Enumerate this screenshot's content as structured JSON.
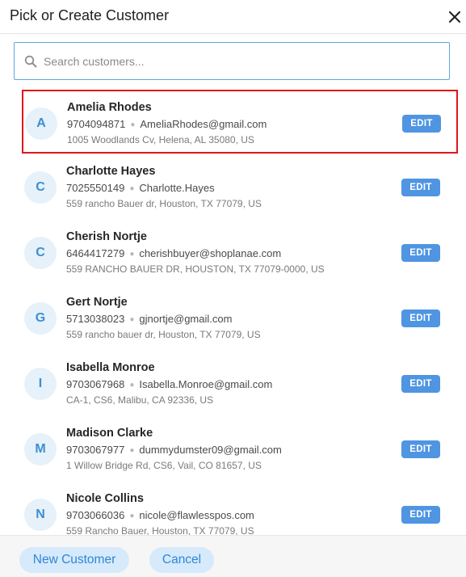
{
  "dialog": {
    "title": "Pick or Create Customer",
    "close_icon": "close-icon"
  },
  "search": {
    "placeholder": "Search customers...",
    "value": "",
    "icon": "search-icon"
  },
  "customers": [
    {
      "initial": "A",
      "name": "Amelia Rhodes",
      "phone": "9704094871",
      "email": "AmeliaRhodes@gmail.com",
      "address": "1005 Woodlands Cv, Helena, AL 35080, US",
      "selected": true
    },
    {
      "initial": "C",
      "name": "Charlotte Hayes",
      "phone": "7025550149",
      "email": "Charlotte.Hayes",
      "address": "559 rancho Bauer dr, Houston, TX 77079, US",
      "selected": false
    },
    {
      "initial": "C",
      "name": "Cherish Nortje",
      "phone": "6464417279",
      "email": "cherishbuyer@shoplanae.com",
      "address": "559 RANCHO BAUER DR, HOUSTON, TX 77079-0000, US",
      "selected": false
    },
    {
      "initial": "G",
      "name": "Gert Nortje",
      "phone": "5713038023",
      "email": "gjnortje@gmail.com",
      "address": "559 rancho bauer dr, Houston, TX 77079, US",
      "selected": false
    },
    {
      "initial": "I",
      "name": "Isabella Monroe",
      "phone": "9703067968",
      "email": "Isabella.Monroe@gmail.com",
      "address": "CA-1, CS6, Malibu, CA 92336, US",
      "selected": false
    },
    {
      "initial": "M",
      "name": "Madison Clarke",
      "phone": "9703067977",
      "email": "dummydumster09@gmail.com",
      "address": "1 Willow Bridge Rd, CS6, Vail, CO 81657, US",
      "selected": false
    },
    {
      "initial": "N",
      "name": "Nicole Collins",
      "phone": "9703066036",
      "email": "nicole@flawlesspos.com",
      "address": "559 Rancho Bauer, Houston, TX 77079, US",
      "selected": false
    }
  ],
  "edit_label": "EDIT",
  "footer": {
    "new_customer": "New Customer",
    "cancel": "Cancel"
  },
  "colors": {
    "accent": "#4f95e2",
    "selection_border": "#e0161b",
    "avatar_bg": "#e6f1fa",
    "pill_bg": "#d6eafb"
  }
}
